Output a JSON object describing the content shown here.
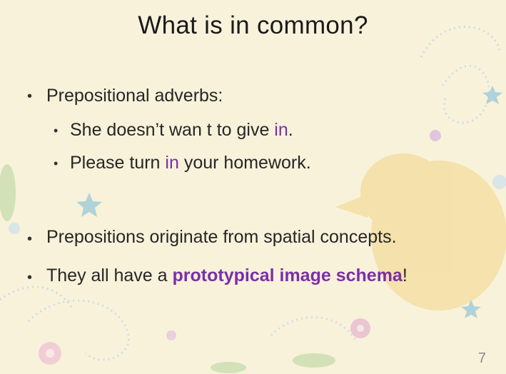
{
  "slide": {
    "title": "What is in common?",
    "bullets": {
      "b1": "Prepositional adverbs:",
      "s1_pre": "She doesn’t wan t to give ",
      "s1_hl": "in",
      "s1_post": ".",
      "s2_pre": "Please turn ",
      "s2_hl": "in",
      "s2_post": " your homework.",
      "b2": "Prepositions originate from spatial concepts.",
      "b3_pre": "They all have a ",
      "b3_strong": "prototypical image schema",
      "b3_post": "!"
    },
    "bullet_glyph": "•",
    "page_number": "7"
  },
  "colors": {
    "background": "#f8f2da",
    "highlight": "#7b2fa8",
    "text": "#262626"
  }
}
